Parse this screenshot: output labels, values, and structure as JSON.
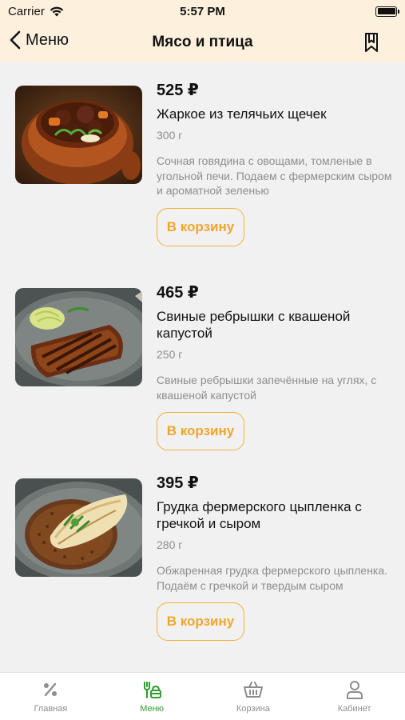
{
  "status_bar": {
    "carrier": "Carrier",
    "time": "5:57 PM"
  },
  "nav": {
    "back_label": "Меню",
    "title": "Мясо и птица"
  },
  "products": [
    {
      "price": "525 ₽",
      "name": "Жаркое из телячьих щечек",
      "weight": "300 г",
      "description": "Сочная говядина с овощами, томленые в угольной печи. Подаем с фермерским сыром и ароматной зеленью",
      "cart_label": "В корзину"
    },
    {
      "price": "465 ₽",
      "name": "Свиные ребрышки с квашеной капустой",
      "weight": "250 г",
      "description": "Свиные ребрышки запечённые на углях, с квашеной капустой",
      "cart_label": "В корзину"
    },
    {
      "price": "395 ₽",
      "name": "Грудка фермерского цыпленка с гречкой и сыром",
      "weight": "280 г",
      "description": "Обжаренная грудка фермерского цыпленка. Подаём с гречкой и твердым сыром",
      "cart_label": "В корзину"
    }
  ],
  "tab_bar": {
    "tabs": [
      {
        "label": "Главная",
        "icon": "percent-icon"
      },
      {
        "label": "Меню",
        "icon": "menu-dish-icon"
      },
      {
        "label": "Корзина",
        "icon": "basket-icon"
      },
      {
        "label": "Кабинет",
        "icon": "user-icon"
      }
    ],
    "active_index": 1
  },
  "colors": {
    "accent": "#f0a62c",
    "active_tab": "#2e9e2e",
    "header_bg": "#fdf1dd",
    "page_bg": "#f1f1f2"
  }
}
